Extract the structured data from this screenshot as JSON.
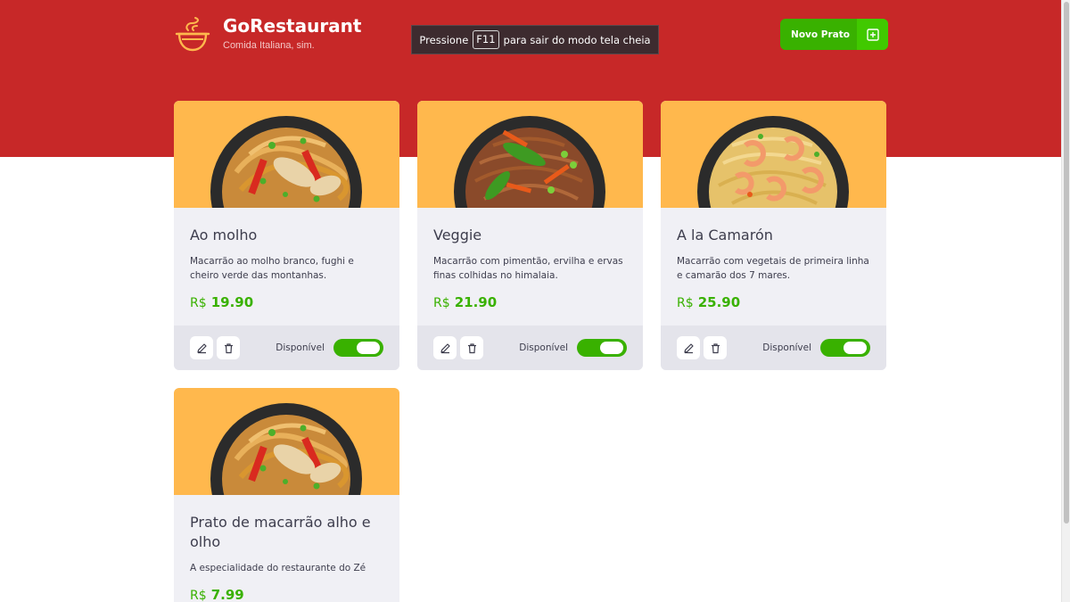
{
  "app": {
    "title": "GoRestaurant",
    "subtitle": "Comida Italiana, sim."
  },
  "fullscreen_notice": {
    "prefix": "Pressione",
    "key": "F11",
    "suffix": "para sair do modo tela cheia"
  },
  "header": {
    "new_dish_label": "Novo Prato"
  },
  "colors": {
    "brand_red": "#c72828",
    "accent_green": "#39b100",
    "card_image_bg": "#ffb84d"
  },
  "currency": "R$",
  "availability_label": "Disponível",
  "dishes": [
    {
      "name": "Ao molho",
      "description": "Macarrão ao molho branco, fughi e cheiro verde das montanhas.",
      "price": "19.90",
      "available": true,
      "image": "stir-fried-noodles-bowl"
    },
    {
      "name": "Veggie",
      "description": "Macarrão com pimentão, ervilha e ervas finas colhidas no himalaia.",
      "price": "21.90",
      "available": true,
      "image": "veggie-noodles-bowl"
    },
    {
      "name": "A la Camarón",
      "description": "Macarrão com vegetais de primeira linha e camarão dos 7 mares.",
      "price": "25.90",
      "available": true,
      "image": "shrimp-noodles-bowl"
    },
    {
      "name": "Prato de macarrão alho e olho",
      "description": "A especialidade do restaurante do Zé",
      "price": "7.99",
      "available": true,
      "image": "stir-fried-noodles-bowl"
    }
  ]
}
